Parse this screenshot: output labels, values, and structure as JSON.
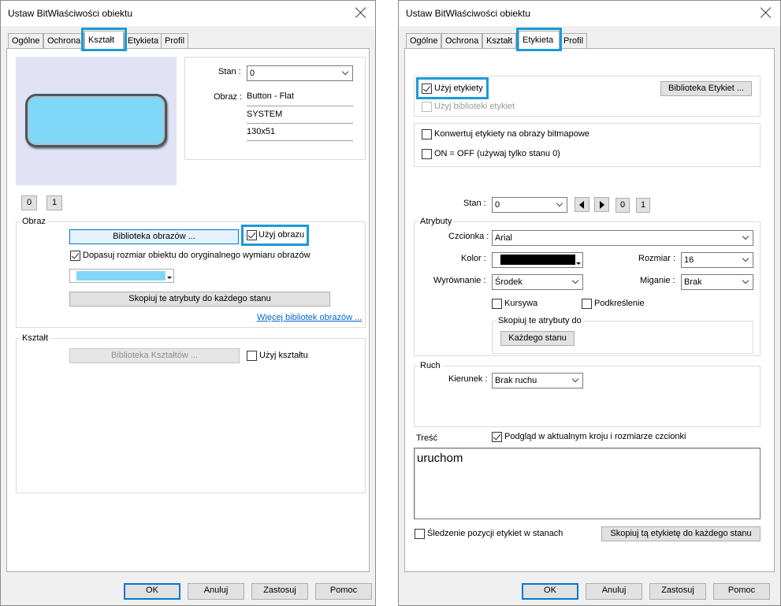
{
  "left": {
    "title": "Ustaw BitWłaściwości obiektu",
    "tabs": [
      "Ogólne",
      "Ochrona",
      "Kształt",
      "Etykieta",
      "Profil"
    ],
    "stan_label": "Stan :",
    "stan_value": "0",
    "obraz_label": "Obraz :",
    "image_info": [
      "Button - Flat",
      "SYSTEM",
      "130x51"
    ],
    "state_buttons": [
      "0",
      "1"
    ],
    "group_obraz": "Obraz",
    "image_library_button": "Biblioteka obrazów ...",
    "use_image_checkbox": "Użyj obrazu",
    "fit_checkbox": "Dopasuj rozmiar obiektu do oryginalnego wymiaru obrazów",
    "copy_attr_button": "Skopiuj te atrybuty do każdego stanu",
    "more_libraries_link": "Więcej bibliotek obrazów ...",
    "group_shape": "Kształt",
    "shape_library_button": "Biblioteka Kształtów ...",
    "use_shape_checkbox": "Użyj kształtu",
    "colors": {
      "preview_bg": "#e2e2f7",
      "button_fill": "#80d8f8",
      "swatch": "#80d8f8"
    }
  },
  "right": {
    "title": "Ustaw BitWłaściwości obiektu",
    "tabs": [
      "Ogólne",
      "Ochrona",
      "Kształt",
      "Etykieta",
      "Profil"
    ],
    "use_label_checkbox": "Użyj etykiety",
    "use_label_library_checkbox": "Użyj biblioteki etykiet",
    "label_library_button": "Biblioteka Etykiet ...",
    "convert_checkbox": "Konwertuj etykiety na obrazy bitmapowe",
    "on_off_checkbox": "ON = OFF (używaj tylko stanu 0)",
    "stan_label": "Stan :",
    "stan_value": "0",
    "state_buttons": [
      "0",
      "1"
    ],
    "group_attrs": "Atrybuty",
    "font_label": "Czcionka :",
    "font_value": "Arial",
    "color_label": "Kolor :",
    "size_label": "Rozmiar :",
    "size_value": "16",
    "align_label": "Wyrównanie :",
    "align_value": "Środek",
    "blink_label": "Miganie :",
    "blink_value": "Brak",
    "italic_checkbox": "Kursywa",
    "underline_checkbox": "Podkreślenie",
    "copy_attrs_group": "Skopiuj te atrybuty do",
    "each_state_button": "Każdego stanu",
    "group_motion": "Ruch",
    "direction_label": "Kierunek :",
    "direction_value": "Brak ruchu",
    "content_label": "Treść",
    "preview_checkbox": "Podgląd w aktualnym kroju i rozmiarze czcionki",
    "content_text": "uruchom",
    "tracking_checkbox": "Śledzenie pozycji etykiet w stanach",
    "copy_label_button": "Skopiuj tą etykietę do każdego stanu",
    "colors": {
      "font_color": "#000000"
    }
  },
  "footer": {
    "ok": "OK",
    "cancel": "Anuluj",
    "apply": "Zastosuj",
    "help": "Pomoc"
  },
  "accent": "#1a9ad6"
}
